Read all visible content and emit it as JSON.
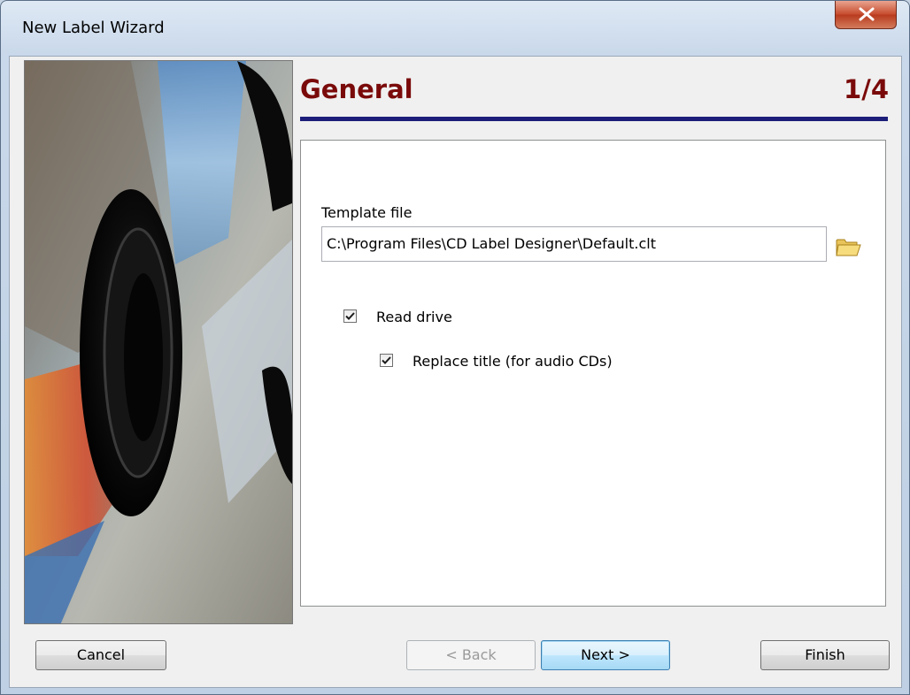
{
  "window": {
    "title": "New Label Wizard",
    "close_symbol": "✕"
  },
  "header": {
    "title": "General",
    "step": "1/4"
  },
  "form": {
    "template_label": "Template file",
    "template_value": "C:\\Program Files\\CD Label Designer\\Default.clt",
    "read_drive_label": "Read drive",
    "read_drive_checked": true,
    "replace_title_label": "Replace title (for audio CDs)",
    "replace_title_checked": true
  },
  "buttons": {
    "cancel": "Cancel",
    "back": "< Back",
    "next": "Next >",
    "finish": "Finish"
  },
  "colors": {
    "heading": "#7a0a0a",
    "rule": "#1c1e7a",
    "close": "#c64a2c"
  },
  "icons": {
    "folder": "folder-open-icon",
    "close": "close-icon",
    "check": "checkmark-icon"
  }
}
